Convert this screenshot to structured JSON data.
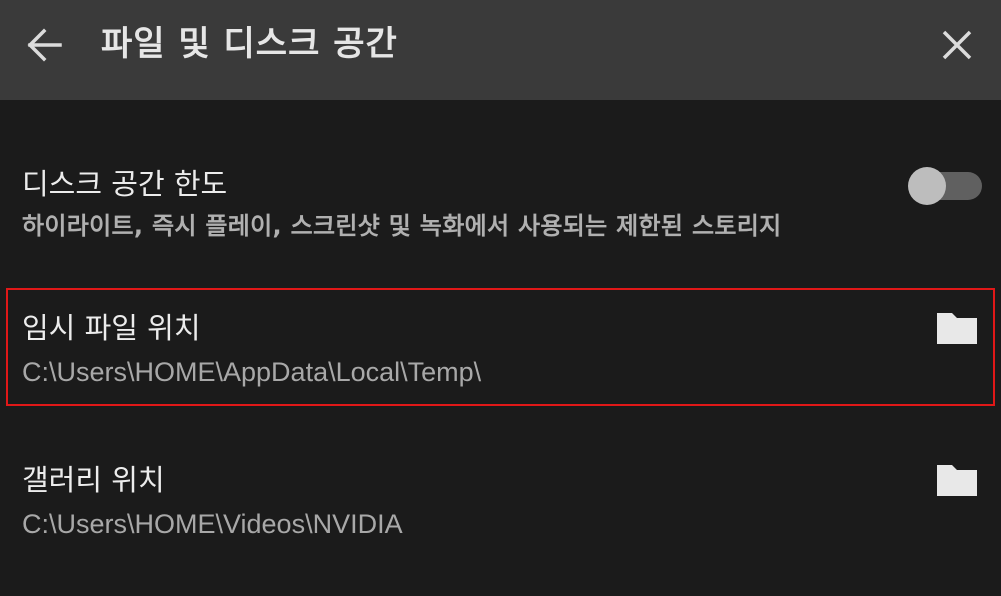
{
  "header": {
    "title": "파일 및 디스크 공간",
    "back_icon": "arrow-left-icon",
    "close_icon": "close-icon",
    "background": "#3a3a3a"
  },
  "settings": {
    "disk_limit": {
      "title": "디스크 공간 한도",
      "description": "하이라이트, 즉시 플레이, 스크린샷 및 녹화에서 사용되는 제한된 스토리지",
      "toggle_on": false
    },
    "temp_location": {
      "title": "임시 파일 위치",
      "path": "C:\\Users\\HOME\\AppData\\Local\\Temp\\",
      "icon": "folder-icon",
      "highlighted": true,
      "highlight_color": "#e01818"
    },
    "gallery_location": {
      "title": "갤러리 위치",
      "path": "C:\\Users\\HOME\\Videos\\NVIDIA",
      "icon": "folder-icon"
    }
  }
}
